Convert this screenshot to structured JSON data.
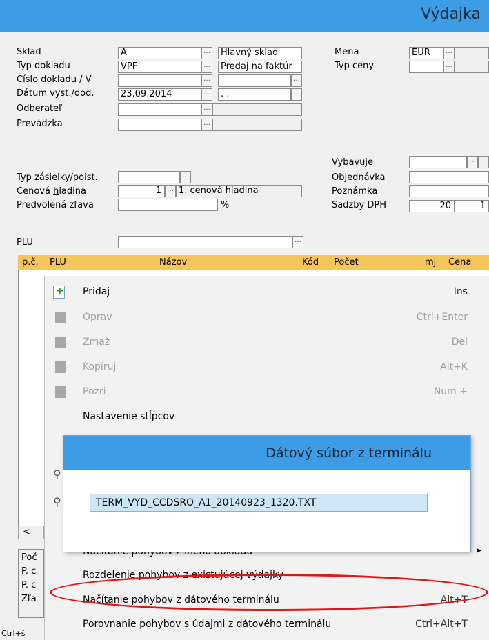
{
  "window": {
    "title": "Výdajka"
  },
  "form": {
    "sklad": {
      "label": "Sklad",
      "code": "A",
      "name": "Hlavný sklad"
    },
    "typ_dokladu": {
      "label": "Typ dokladu",
      "code": "VPF",
      "name": "Predaj na faktúr"
    },
    "cislo_dokladu": {
      "label": "Číslo dokladu / V"
    },
    "datum": {
      "label": "Dátum vyst./dod.",
      "value": "23.09.2014",
      "value2": ". ."
    },
    "odberatel": {
      "label": "Odberateľ"
    },
    "prevadzka": {
      "label": "Prevádzka"
    },
    "mena": {
      "label": "Mena",
      "value": "EUR"
    },
    "typ_ceny": {
      "label": "Typ ceny"
    },
    "vybavuje": {
      "label": "Vybavuje"
    },
    "objednavka": {
      "label": "Objednávka"
    },
    "poznamka": {
      "label": "Poznámka"
    },
    "sadzby_dph": {
      "label": "Sadzby DPH",
      "v1": "20",
      "v2": "1"
    },
    "typ_zasielky": {
      "label": "Typ zásielky/poist."
    },
    "cenova_hladina": {
      "label_pre": "Cenová ",
      "label_u": "h",
      "label_post": "ladina",
      "num": "1",
      "name": "1. cenová hladina"
    },
    "zlava": {
      "label": "Predvolená zľava",
      "unit": "%"
    },
    "plu": {
      "label": "PLU"
    }
  },
  "grid": {
    "columns": [
      "p.č.",
      "PLU",
      "Názov",
      "Kód",
      "Počet",
      "mj",
      "Cena"
    ]
  },
  "bottom_labels": [
    "Poč",
    "P. c",
    "P. c",
    "Zľa"
  ],
  "status_partial": "Ctrl+š",
  "scroll_left": "<",
  "context_menu": {
    "items": [
      {
        "label": "Pridaj",
        "shortcut": "Ins",
        "enabled": true
      },
      {
        "label": "Oprav",
        "shortcut": "Ctrl+Enter",
        "enabled": false
      },
      {
        "label": "Zmaž",
        "shortcut": "Del",
        "enabled": false
      },
      {
        "label": "Kopíruj",
        "shortcut": "Alt+K",
        "enabled": false
      },
      {
        "label": "Pozri",
        "shortcut": "Num +",
        "enabled": false
      },
      {
        "label": "Nastavenie stĺpcov",
        "shortcut": "",
        "enabled": true
      }
    ],
    "lower_items": [
      {
        "label": "Načítanie pohybov z iného dokladu",
        "shortcut": ""
      },
      {
        "label": "Rozdelenie pohybov z existujúcej výdajky",
        "shortcut": ""
      },
      {
        "label": "Načítanie pohybov z dátového terminálu",
        "shortcut": "Alt+T"
      },
      {
        "label": "Porovnanie pohybov s údajmi z dátového terminálu",
        "shortcut": "Ctrl+Alt+T"
      }
    ],
    "submenu_arrow": "▸"
  },
  "dialog": {
    "title": "Dátový súbor z terminálu",
    "file": "TERM_VYD_CCDSRO_A1_20140923_1320.TXT"
  },
  "colors": {
    "titlebar": "#3d9ce6",
    "grid_header": "#f5c65a",
    "highlight": "#e51515"
  }
}
